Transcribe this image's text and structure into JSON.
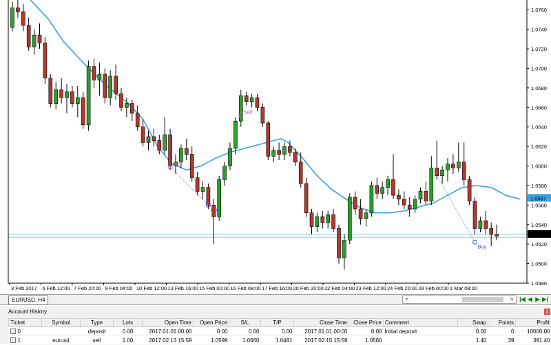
{
  "chart_data": {
    "type": "candlestick",
    "symbol_timeframe": "EURUSD, H4",
    "price_axis": {
      "min": 1.048,
      "max": 1.077,
      "ticks": [
        "1.0760",
        "1.0740",
        "1.0720",
        "1.0700",
        "1.0680",
        "1.0660",
        "1.0640",
        "1.0620",
        "1.0600",
        "1.0580",
        "1.0560",
        "1.0540",
        "1.0520",
        "1.0500",
        "1.0480"
      ],
      "ma_marker": "1.0567",
      "bid_marker": "1.0530",
      "bid_marker_value": 1.053,
      "horizontal_lines": [
        1.053,
        1.0527
      ]
    },
    "time_axis_labels": [
      "3 Feb 2017",
      "6 Feb 12:00",
      "7 Feb 20:00",
      "9 Feb 04:00",
      "10 Feb 12:00",
      "13 Feb 16:00",
      "15 Feb 00:00",
      "16 Feb 08:00",
      "17 Feb 16:00",
      "20 Feb 20:00",
      "22 Feb 04:00",
      "23 Feb 12:00",
      "24 Feb 20:00",
      "28 Feb 00:00",
      "1 Mar 08:00"
    ],
    "candles": [
      [
        1.0742,
        1.0768,
        1.0738,
        1.0762
      ],
      [
        1.0762,
        1.077,
        1.0752,
        1.0758
      ],
      [
        1.0758,
        1.0766,
        1.0738,
        1.0744
      ],
      [
        1.0744,
        1.0752,
        1.0718,
        1.0722
      ],
      [
        1.0722,
        1.074,
        1.0714,
        1.0734
      ],
      [
        1.0734,
        1.0746,
        1.072,
        1.0726
      ],
      [
        1.0726,
        1.0732,
        1.0684,
        1.069
      ],
      [
        1.069,
        1.0694,
        1.066,
        1.0664
      ],
      [
        1.0664,
        1.0686,
        1.0658,
        1.0678
      ],
      [
        1.0678,
        1.069,
        1.0664,
        1.067
      ],
      [
        1.067,
        1.0684,
        1.0654,
        1.0676
      ],
      [
        1.0676,
        1.0682,
        1.066,
        1.0664
      ],
      [
        1.0664,
        1.0682,
        1.065,
        1.067
      ],
      [
        1.067,
        1.0676,
        1.0638,
        1.0642
      ],
      [
        1.0642,
        1.0708,
        1.0636,
        1.0702
      ],
      [
        1.0702,
        1.071,
        1.068,
        1.0688
      ],
      [
        1.0688,
        1.0706,
        1.0672,
        1.0694
      ],
      [
        1.0694,
        1.07,
        1.0664,
        1.067
      ],
      [
        1.067,
        1.0698,
        1.0662,
        1.0692
      ],
      [
        1.0692,
        1.0704,
        1.0668,
        1.0674
      ],
      [
        1.0674,
        1.068,
        1.0656,
        1.066
      ],
      [
        1.066,
        1.067,
        1.065,
        1.0664
      ],
      [
        1.0664,
        1.0668,
        1.0646,
        1.0654
      ],
      [
        1.0654,
        1.0662,
        1.0636,
        1.064
      ],
      [
        1.064,
        1.0648,
        1.062,
        1.0624
      ],
      [
        1.0624,
        1.0636,
        1.0616,
        1.063
      ],
      [
        1.063,
        1.0638,
        1.062,
        1.0626
      ],
      [
        1.0626,
        1.0632,
        1.0612,
        1.0616
      ],
      [
        1.0616,
        1.065,
        1.0612,
        1.0632
      ],
      [
        1.0632,
        1.0638,
        1.0596,
        1.06
      ],
      [
        1.06,
        1.0612,
        1.0592,
        1.0604
      ],
      [
        1.0604,
        1.0622,
        1.0598,
        1.0618
      ],
      [
        1.0618,
        1.0628,
        1.0606,
        1.0612
      ],
      [
        1.0612,
        1.062,
        1.0584,
        1.0588
      ],
      [
        1.0588,
        1.0594,
        1.057,
        1.0574
      ],
      [
        1.0574,
        1.0584,
        1.0566,
        1.0578
      ],
      [
        1.0578,
        1.0582,
        1.0556,
        1.056
      ],
      [
        1.056,
        1.0566,
        1.052,
        1.0548
      ],
      [
        1.0548,
        1.059,
        1.0544,
        1.0586
      ],
      [
        1.0586,
        1.0604,
        1.058,
        1.06
      ],
      [
        1.06,
        1.0624,
        1.0596,
        1.0618
      ],
      [
        1.0618,
        1.065,
        1.0612,
        1.0646
      ],
      [
        1.0646,
        1.0678,
        1.064,
        1.0672
      ],
      [
        1.0672,
        1.0676,
        1.0662,
        1.0666
      ],
      [
        1.0666,
        1.0674,
        1.066,
        1.067
      ],
      [
        1.067,
        1.0674,
        1.0656,
        1.066
      ],
      [
        1.066,
        1.0664,
        1.064,
        1.0644
      ],
      [
        1.0644,
        1.0646,
        1.0606,
        1.061
      ],
      [
        1.061,
        1.062,
        1.0604,
        1.0616
      ],
      [
        1.0616,
        1.0624,
        1.0606,
        1.0612
      ],
      [
        1.0612,
        1.0624,
        1.0606,
        1.062
      ],
      [
        1.062,
        1.0626,
        1.061,
        1.0614
      ],
      [
        1.0614,
        1.0618,
        1.06,
        1.0604
      ],
      [
        1.0604,
        1.0614,
        1.0578,
        1.0582
      ],
      [
        1.0582,
        1.0588,
        1.0548,
        1.0552
      ],
      [
        1.0552,
        1.0556,
        1.053,
        1.0538
      ],
      [
        1.0538,
        1.0552,
        1.0532,
        1.0548
      ],
      [
        1.0548,
        1.0554,
        1.0536,
        1.0542
      ],
      [
        1.0542,
        1.0554,
        1.0536,
        1.055
      ],
      [
        1.055,
        1.0556,
        1.0532,
        1.0536
      ],
      [
        1.0536,
        1.054,
        1.05,
        1.0506
      ],
      [
        1.0506,
        1.053,
        1.0494,
        1.0524
      ],
      [
        1.0524,
        1.0572,
        1.052,
        1.0568
      ],
      [
        1.0568,
        1.0574,
        1.055,
        1.0556
      ],
      [
        1.0556,
        1.0566,
        1.054,
        1.0546
      ],
      [
        1.0546,
        1.0556,
        1.0538,
        1.0552
      ],
      [
        1.0552,
        1.0584,
        1.0548,
        1.058
      ],
      [
        1.058,
        1.0588,
        1.0566,
        1.0572
      ],
      [
        1.0572,
        1.0584,
        1.0566,
        1.0578
      ],
      [
        1.0578,
        1.059,
        1.057,
        1.0586
      ],
      [
        1.0586,
        1.0612,
        1.0566,
        1.057
      ],
      [
        1.057,
        1.0576,
        1.056,
        1.0566
      ],
      [
        1.0566,
        1.0574,
        1.0556,
        1.056
      ],
      [
        1.056,
        1.0568,
        1.0548,
        1.0556
      ],
      [
        1.0556,
        1.057,
        1.0552,
        1.0566
      ],
      [
        1.0566,
        1.0578,
        1.0562,
        1.0574
      ],
      [
        1.0574,
        1.0584,
        1.056,
        1.0564
      ],
      [
        1.0564,
        1.061,
        1.056,
        1.0598
      ],
      [
        1.0598,
        1.0626,
        1.0586,
        1.059
      ],
      [
        1.059,
        1.06,
        1.0582,
        1.0596
      ],
      [
        1.0596,
        1.0608,
        1.0584,
        1.0602
      ],
      [
        1.0602,
        1.0612,
        1.0592,
        1.0598
      ],
      [
        1.0598,
        1.0624,
        1.0594,
        1.0604
      ],
      [
        1.0604,
        1.0624,
        1.058,
        1.0586
      ],
      [
        1.0586,
        1.059,
        1.056,
        1.0564
      ],
      [
        1.0564,
        1.0568,
        1.053,
        1.0536
      ],
      [
        1.0536,
        1.0548,
        1.0532,
        1.0544
      ],
      [
        1.0544,
        1.0554,
        1.053,
        1.0536
      ],
      [
        1.0536,
        1.0542,
        1.0518,
        1.053
      ],
      [
        1.053,
        1.054,
        1.0524,
        1.0528
      ]
    ],
    "moving_average": [
      [
        0,
        1.079
      ],
      [
        6,
        1.0766
      ],
      [
        10,
        1.075
      ],
      [
        14,
        1.0728
      ],
      [
        20,
        1.0704
      ],
      [
        26,
        1.0682
      ],
      [
        32,
        1.0664
      ],
      [
        36,
        1.0648
      ],
      [
        40,
        1.062
      ],
      [
        44,
        1.0602
      ],
      [
        48,
        1.0596
      ],
      [
        52,
        1.06
      ],
      [
        56,
        1.0608
      ],
      [
        60,
        1.0614
      ],
      [
        64,
        1.0618
      ],
      [
        68,
        1.0622
      ],
      [
        72,
        1.0626
      ],
      [
        74,
        1.0628
      ],
      [
        76,
        1.0624
      ],
      [
        80,
        1.0608
      ],
      [
        84,
        1.059
      ],
      [
        88,
        1.0576
      ],
      [
        92,
        1.0566
      ],
      [
        96,
        1.0557
      ],
      [
        100,
        1.0552
      ],
      [
        104,
        1.0552
      ],
      [
        108,
        1.0554
      ],
      [
        112,
        1.0558
      ],
      [
        116,
        1.0562
      ],
      [
        120,
        1.057
      ],
      [
        124,
        1.0578
      ],
      [
        128,
        1.058
      ],
      [
        132,
        1.0578
      ],
      [
        136,
        1.057
      ],
      [
        140,
        1.0566
      ]
    ],
    "trades": [
      {
        "label": "Sell",
        "kind": "sell",
        "candle": 29,
        "price": 1.0599,
        "color": "#e040c0"
      },
      {
        "label": "Buy",
        "kind": "buy",
        "candle": 36,
        "price": 1.056,
        "color": "#3050c0"
      },
      {
        "label": "Sell",
        "kind": "sell",
        "candle": 42,
        "price": 1.0652,
        "color": "#e040c0"
      },
      {
        "label": "Buy",
        "kind": "buy",
        "candle": 85,
        "price": 1.0522,
        "color": "#3050c0"
      }
    ],
    "trade_links": [
      [
        29,
        1.0599,
        36,
        1.056
      ],
      [
        78,
        1.059,
        85,
        1.0522
      ]
    ],
    "colors": {
      "bull": "#2ca02c",
      "bear": "#b03a2e",
      "ma": "#3da0e0",
      "bid_line": "#8fd0d0"
    }
  },
  "tabbar": {
    "symbol_tab": "EURUSD, H4",
    "scroll_left": "<",
    "scroll_right": ">",
    "nav": [
      "|◀",
      "◀",
      "▶",
      "▶|"
    ]
  },
  "account_history": {
    "title": "Account History",
    "close": "x",
    "columns": [
      "Ticket",
      "Symbol",
      "Type",
      "Lots",
      "Open Time",
      "Open Price",
      "S/L",
      "T/P",
      "Close Time",
      "Close Price",
      "Comment",
      "Swap",
      "Points",
      "Profit"
    ],
    "rows": [
      {
        "ticket": "0",
        "symbol": "",
        "type": "deposit",
        "lots": "0.00",
        "open_time": "2017.01.01 00:00",
        "open_price": "0.00",
        "sl": "0.00",
        "tp": "0.00",
        "close_time": "2017.01.01 00:00",
        "close_price": "0.00",
        "comment": "Initial deposit",
        "swap": "0.00",
        "points": "0",
        "profit": "10000.00"
      },
      {
        "ticket": "1",
        "symbol": "eurusd",
        "type": "sell",
        "lots": "1.00",
        "open_time": "2017.02.13 15:59",
        "open_price": "1.0599",
        "sl": "1.0660",
        "tp": "1.0481",
        "close_time": "2017.02.15 15:59",
        "close_price": "1.0560",
        "comment": "",
        "swap": "1.40",
        "points": "39",
        "profit": "391.40"
      }
    ]
  }
}
